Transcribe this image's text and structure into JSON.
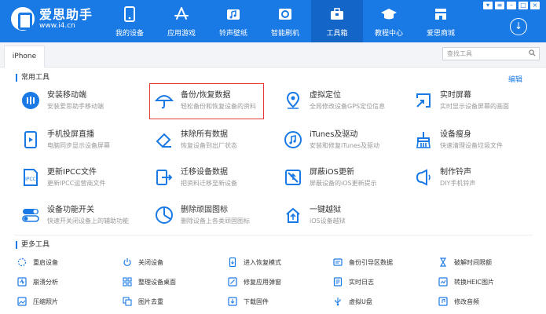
{
  "app": {
    "title": "爱思助手",
    "url": "www.i4.cn"
  },
  "nav": [
    {
      "label": "我的设备",
      "icon": "phone-icon"
    },
    {
      "label": "应用游戏",
      "icon": "app-store-icon"
    },
    {
      "label": "铃声壁纸",
      "icon": "music-icon"
    },
    {
      "label": "智能刷机",
      "icon": "flash-icon"
    },
    {
      "label": "工具箱",
      "icon": "toolbox-icon",
      "active": true
    },
    {
      "label": "教程中心",
      "icon": "graduation-cap-icon"
    },
    {
      "label": "爱思商城",
      "icon": "shop-icon"
    }
  ],
  "tabs": {
    "device": "iPhone"
  },
  "search": {
    "placeholder": "查找工具"
  },
  "common_tools": {
    "title": "常用工具",
    "edit": "编辑",
    "items": [
      {
        "name": "安装移动端",
        "desc": "安装爱思助手移动端",
        "icon": "install-icon"
      },
      {
        "name": "备份/恢复数据",
        "desc": "轻松备份和恢复设备的资料",
        "icon": "umbrella-icon"
      },
      {
        "name": "虚拟定位",
        "desc": "全局修改设备GPS定位信息",
        "icon": "location-icon"
      },
      {
        "name": "实时屏幕",
        "desc": "实时显示设备屏幕的画面",
        "icon": "screen-icon"
      },
      {
        "name": "手机投屏直播",
        "desc": "电脑同步显示设备屏幕",
        "icon": "mirror-icon"
      },
      {
        "name": "抹除所有数据",
        "desc": "恢复设备到出厂状态",
        "icon": "eraser-icon"
      },
      {
        "name": "iTunes及驱动",
        "desc": "安装和修复iTunes及驱动",
        "icon": "itunes-icon"
      },
      {
        "name": "设备瘦身",
        "desc": "快速清理设备垃圾文件",
        "icon": "broom-icon"
      },
      {
        "name": "更新IPCC文件",
        "desc": "更新IPCC运营商文件",
        "icon": "ipcc-icon"
      },
      {
        "name": "迁移设备数据",
        "desc": "把资料迁移至新设备",
        "icon": "migrate-icon"
      },
      {
        "name": "屏蔽iOS更新",
        "desc": "屏蔽设备的iOS更新提示",
        "icon": "block-update-icon"
      },
      {
        "name": "制作铃声",
        "desc": "DIY手机铃声",
        "icon": "ringtone-icon"
      },
      {
        "name": "设备功能开关",
        "desc": "快速开关闭设备上的辅助功能",
        "icon": "toggle-icon"
      },
      {
        "name": "删除顽固图标",
        "desc": "删除设备上各类顽固图标",
        "icon": "pie-icon"
      },
      {
        "name": "一键越狱",
        "desc": "iOS设备越狱",
        "icon": "jailbreak-icon"
      }
    ]
  },
  "more_tools": {
    "title": "更多工具",
    "items": [
      {
        "label": "重启设备",
        "icon": "restart-icon"
      },
      {
        "label": "关闭设备",
        "icon": "power-icon"
      },
      {
        "label": "进入恢复模式",
        "icon": "recovery-icon"
      },
      {
        "label": "备份引导区数据",
        "icon": "backup-boot-icon"
      },
      {
        "label": "破解时间限额",
        "icon": "hourglass-icon"
      },
      {
        "label": "崩溃分析",
        "icon": "crash-icon"
      },
      {
        "label": "整理设备桌面",
        "icon": "grid-icon"
      },
      {
        "label": "修复应用弹窗",
        "icon": "repair-icon"
      },
      {
        "label": "实时日志",
        "icon": "log-icon"
      },
      {
        "label": "转换HEIC图片",
        "icon": "heic-icon"
      },
      {
        "label": "压缩照片",
        "icon": "compress-icon"
      },
      {
        "label": "图片去重",
        "icon": "dedupe-icon"
      },
      {
        "label": "下载固件",
        "icon": "firmware-icon"
      },
      {
        "label": "虚拟U盘",
        "icon": "usb-icon"
      },
      {
        "label": "修改音频",
        "icon": "audio-icon"
      }
    ]
  },
  "colors": {
    "brand": "#1a7ae5",
    "highlight": "#e53935"
  }
}
